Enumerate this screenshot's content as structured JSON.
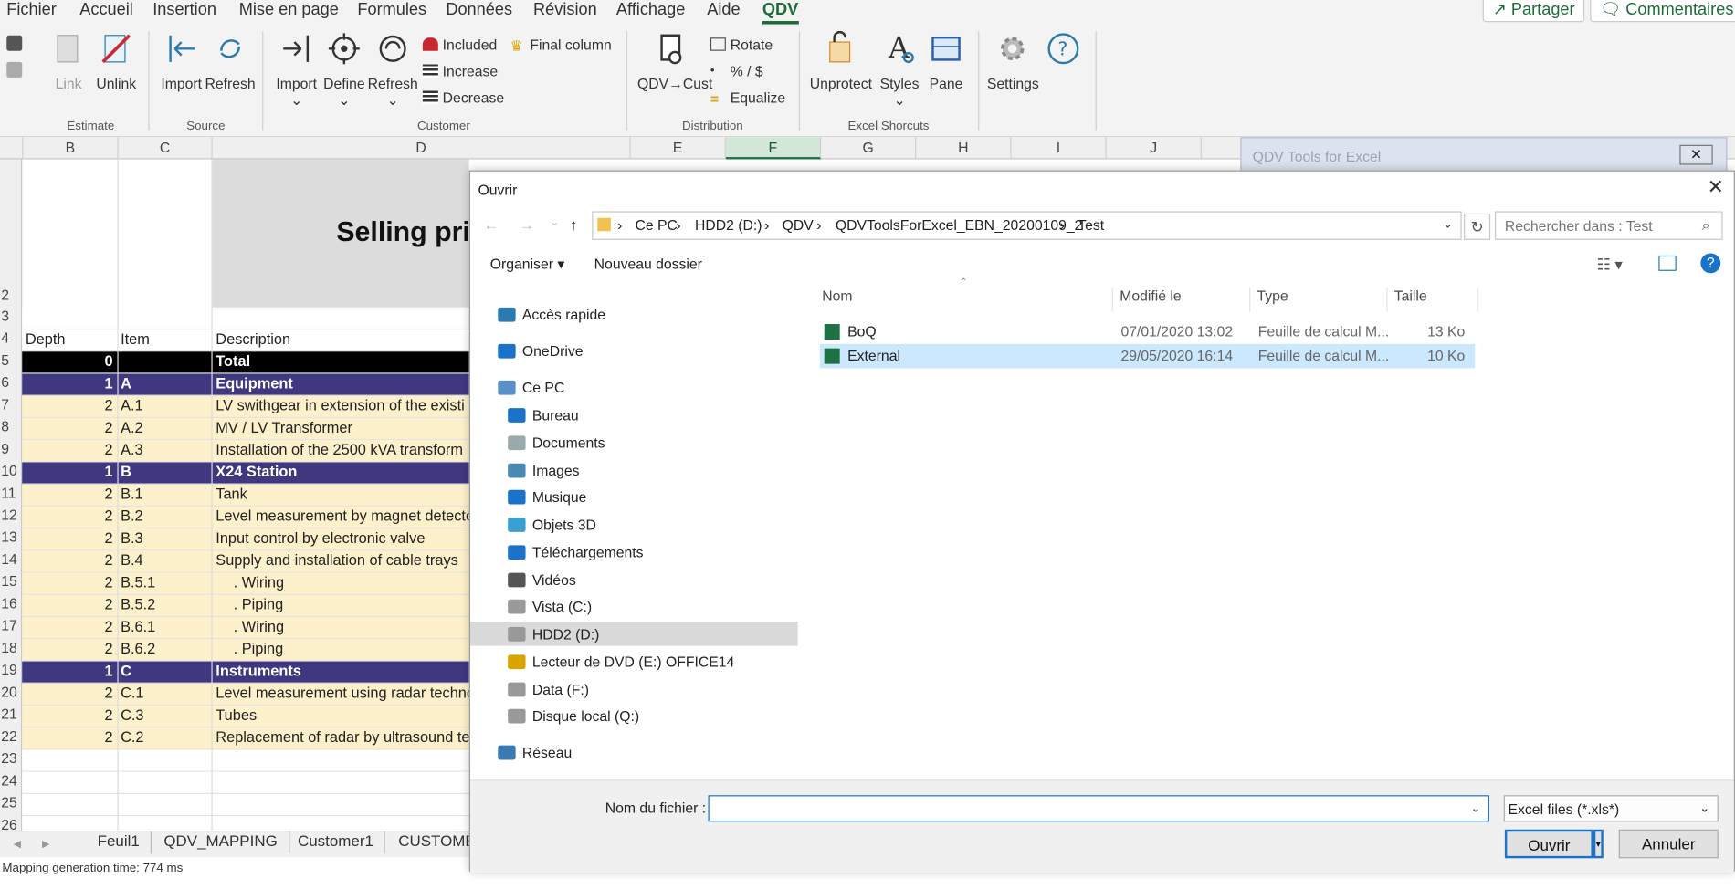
{
  "menu": {
    "items": [
      "Fichier",
      "Accueil",
      "Insertion",
      "Mise en page",
      "Formules",
      "Données",
      "Révision",
      "Affichage",
      "Aide",
      "QDV"
    ],
    "active": "QDV",
    "share": "Partager",
    "comments": "Commentaires"
  },
  "ribbon": {
    "estimate": {
      "label": "Estimate",
      "link": "Link",
      "unlink": "Unlink"
    },
    "source": {
      "label": "Source",
      "import": "Import",
      "refresh": "Refresh"
    },
    "customer": {
      "label": "Customer",
      "import": "Import",
      "define": "Define",
      "refresh": "Refresh",
      "included": "Included",
      "increase": "Increase",
      "decrease": "Decrease",
      "final_column": "Final column"
    },
    "distribution": {
      "label": "Distribution",
      "qdv_cust": "QDV→Cust",
      "rotate": "Rotate",
      "pct": "% / $",
      "equalize": "Equalize"
    },
    "excel": {
      "label": "Excel Shorcuts",
      "unprotect": "Unprotect",
      "styles": "Styles",
      "pane": "Pane"
    },
    "settings": "Settings"
  },
  "grid": {
    "columns": [
      "B",
      "C",
      "D",
      "E",
      "F",
      "G",
      "H",
      "I",
      "J"
    ],
    "selected_column": "F",
    "title_fragment": "Selling pri",
    "headers": {
      "depth": "Depth",
      "item": "Item",
      "description": "Description"
    },
    "rows": [
      {
        "n": "2",
        "depth": "",
        "item": "",
        "desc": "",
        "style": "title"
      },
      {
        "n": "3",
        "depth": "",
        "item": "",
        "desc": "",
        "style": "plain"
      },
      {
        "n": "4",
        "depth": "Depth",
        "item": "Item",
        "desc": "Description",
        "style": "header"
      },
      {
        "n": "5",
        "depth": "0",
        "item": "",
        "desc": "Total",
        "style": "lvl0"
      },
      {
        "n": "6",
        "depth": "1",
        "item": "A",
        "desc": "Equipment",
        "style": "lvl1"
      },
      {
        "n": "7",
        "depth": "2",
        "item": "A.1",
        "desc": "LV swithgear in extension of the existi",
        "style": "lvl2"
      },
      {
        "n": "8",
        "depth": "2",
        "item": "A.2",
        "desc": "MV / LV Transformer",
        "style": "lvl2"
      },
      {
        "n": "9",
        "depth": "2",
        "item": "A.3",
        "desc": "Installation of the 2500 kVA transform",
        "style": "lvl2"
      },
      {
        "n": "10",
        "depth": "1",
        "item": "B",
        "desc": "X24 Station",
        "style": "lvl1"
      },
      {
        "n": "11",
        "depth": "2",
        "item": "B.1",
        "desc": "Tank",
        "style": "lvl2"
      },
      {
        "n": "12",
        "depth": "2",
        "item": "B.2",
        "desc": "Level measurement by magnet detecto",
        "style": "lvl2"
      },
      {
        "n": "13",
        "depth": "2",
        "item": "B.3",
        "desc": "Input control by electronic valve",
        "style": "lvl2"
      },
      {
        "n": "14",
        "depth": "2",
        "item": "B.4",
        "desc": "Supply and installation of cable trays",
        "style": "lvl2"
      },
      {
        "n": "15",
        "depth": "2",
        "item": "B.5.1",
        "desc": ". Wiring",
        "style": "lvl2i"
      },
      {
        "n": "16",
        "depth": "2",
        "item": "B.5.2",
        "desc": ". Piping",
        "style": "lvl2i"
      },
      {
        "n": "17",
        "depth": "2",
        "item": "B.6.1",
        "desc": ". Wiring",
        "style": "lvl2i"
      },
      {
        "n": "18",
        "depth": "2",
        "item": "B.6.2",
        "desc": ". Piping",
        "style": "lvl2i"
      },
      {
        "n": "19",
        "depth": "1",
        "item": "C",
        "desc": "Instruments",
        "style": "lvl1"
      },
      {
        "n": "20",
        "depth": "2",
        "item": "C.1",
        "desc": "Level measurement using radar techno",
        "style": "lvl2"
      },
      {
        "n": "21",
        "depth": "2",
        "item": "C.3",
        "desc": "Tubes",
        "style": "lvl2"
      },
      {
        "n": "22",
        "depth": "2",
        "item": "C.2",
        "desc": "Replacement of radar by ultrasound te",
        "style": "lvl2"
      },
      {
        "n": "23",
        "depth": "",
        "item": "",
        "desc": "",
        "style": "plain"
      },
      {
        "n": "24",
        "depth": "",
        "item": "",
        "desc": "",
        "style": "plain"
      },
      {
        "n": "25",
        "depth": "",
        "item": "",
        "desc": "",
        "style": "plain"
      },
      {
        "n": "26",
        "depth": "",
        "item": "",
        "desc": "",
        "style": "plain"
      }
    ],
    "sheet_tabs": [
      "Feuil1",
      "QDV_MAPPING",
      "Customer1",
      "CUSTOME"
    ],
    "status": "Mapping generation time: 774 ms"
  },
  "qdv_window": {
    "title": "QDV Tools for Excel"
  },
  "dialog": {
    "title": "Ouvrir",
    "path": [
      "Ce PC",
      "HDD2 (D:)",
      "QDV",
      "QDVToolsForExcel_EBN_20200109_2",
      "Test"
    ],
    "search_placeholder": "Rechercher dans : Test",
    "organize": "Organiser",
    "new_folder": "Nouveau dossier",
    "nav": [
      {
        "label": "Accès rapide",
        "icon": "star-icon",
        "level": 0
      },
      {
        "label": "OneDrive",
        "icon": "cloud-icon",
        "level": 0
      },
      {
        "label": "Ce PC",
        "icon": "computer-icon",
        "level": 0
      },
      {
        "label": "Bureau",
        "icon": "desktop-icon",
        "level": 1
      },
      {
        "label": "Documents",
        "icon": "documents-icon",
        "level": 1
      },
      {
        "label": "Images",
        "icon": "images-icon",
        "level": 1
      },
      {
        "label": "Musique",
        "icon": "music-icon",
        "level": 1
      },
      {
        "label": "Objets 3D",
        "icon": "cube-icon",
        "level": 1
      },
      {
        "label": "Téléchargements",
        "icon": "download-icon",
        "level": 1
      },
      {
        "label": "Vidéos",
        "icon": "video-icon",
        "level": 1
      },
      {
        "label": "Vista (C:)",
        "icon": "drive-icon",
        "level": 1
      },
      {
        "label": "HDD2 (D:)",
        "icon": "drive-icon",
        "level": 1,
        "selected": true
      },
      {
        "label": "Lecteur de DVD (E:) OFFICE14",
        "icon": "dvd-icon",
        "level": 1
      },
      {
        "label": "Data (F:)",
        "icon": "drive-icon",
        "level": 1
      },
      {
        "label": "Disque local (Q:)",
        "icon": "drive-icon",
        "level": 1
      },
      {
        "label": "Réseau",
        "icon": "network-icon",
        "level": 0
      }
    ],
    "columns": {
      "name": "Nom",
      "modified": "Modifié le",
      "type": "Type",
      "size": "Taille"
    },
    "files": [
      {
        "name": "BoQ",
        "modified": "07/01/2020 13:02",
        "type": "Feuille de calcul M...",
        "size": "13 Ko",
        "selected": false
      },
      {
        "name": "External",
        "modified": "29/05/2020 16:14",
        "type": "Feuille de calcul M...",
        "size": "10 Ko",
        "selected": true
      }
    ],
    "filename_label": "Nom du fichier :",
    "filename_value": "",
    "filter": "Excel files (*.xls*)",
    "open": "Ouvrir",
    "cancel": "Annuler"
  }
}
